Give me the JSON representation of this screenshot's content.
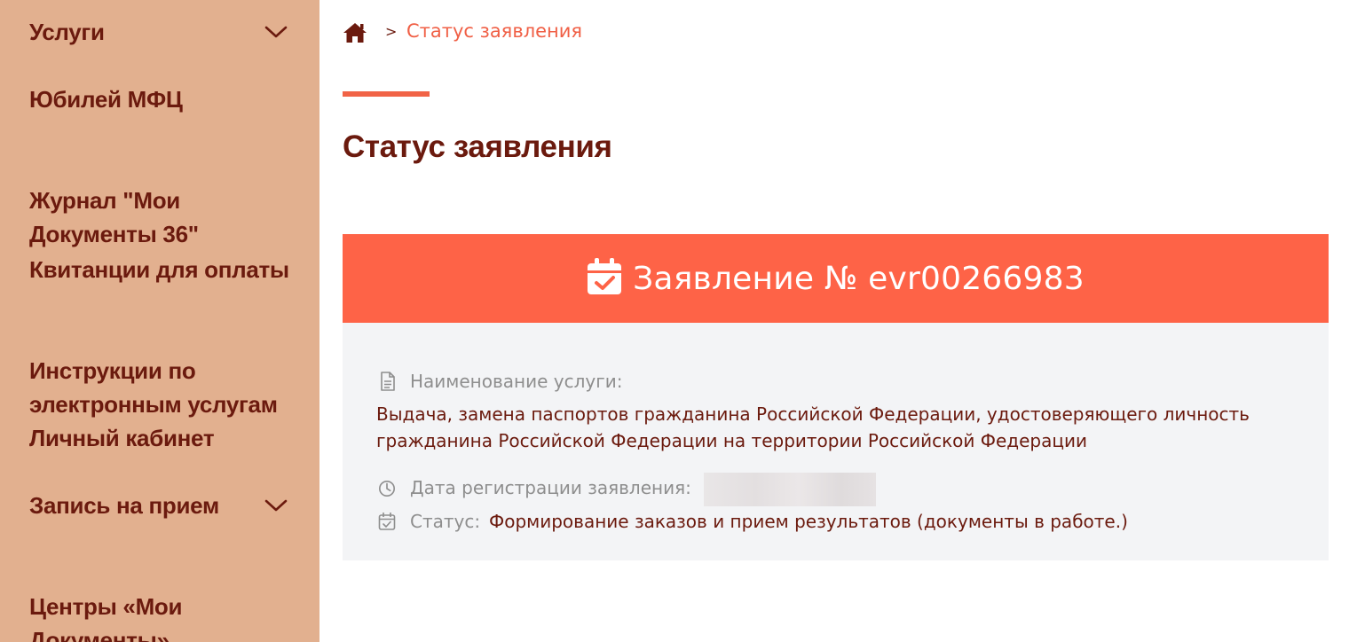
{
  "sidebar": {
    "items": [
      {
        "label": "Услуги",
        "has_dropdown": true
      },
      {
        "label": "Юбилей МФЦ",
        "has_dropdown": false
      },
      {
        "label": "Журнал \"Мои\nДокументы 36\"",
        "has_dropdown": false
      },
      {
        "label": "Квитанции для оплаты",
        "has_dropdown": false
      },
      {
        "label": "Инструкции по\nэлектронным услугам",
        "has_dropdown": false
      },
      {
        "label": "Личный кабинет",
        "has_dropdown": false
      },
      {
        "label": "Запись на прием",
        "has_dropdown": true
      },
      {
        "label": "Центры «Мои\nДокументы»",
        "has_dropdown": false
      }
    ]
  },
  "breadcrumb": {
    "separator": ">",
    "current": "Статус заявления"
  },
  "page": {
    "title": "Статус заявления"
  },
  "application": {
    "header": "Заявление № evr00266983",
    "service_label": "Наименование услуги:",
    "service_value_line1": "Выдача, замена паспортов гражданина Российской Федерации, удостоверяющего личность",
    "service_value_line2": "гражданина Российской Федерации на территории Российской Федерации",
    "registration_label": "Дата регистрации заявления:",
    "status_label": "Статус:",
    "status_value": "Формирование заказов и прием результатов (документы в работе.)"
  },
  "icons": {
    "breadcrumb": "home-icon",
    "header": "calendar-check-icon",
    "service": "document-icon",
    "registration": "clock-icon",
    "status": "calendar-check-icon",
    "dropdown": "chevron-down-icon"
  },
  "colors": {
    "sidebar_bg": "#e2b08f",
    "sidebar_text": "#6b1a0e",
    "accent": "#fe6347",
    "card_body_bg": "#f3f4f6",
    "label_gray": "#8e8e8e"
  }
}
